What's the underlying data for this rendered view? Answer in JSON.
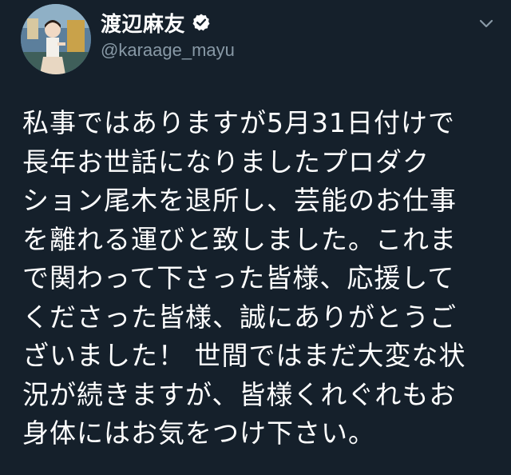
{
  "tweet": {
    "display_name": "渡辺麻友",
    "handle": "@karaage_mayu",
    "verified_icon": "verified-badge-icon",
    "menu_icon": "chevron-down-icon",
    "avatar_icon": "profile-photo",
    "text": "私事ではありますが5月31日付けで\n長年お世話になりましたプロダク\nション尾木を退所し、芸能のお仕事\nを離れる運びと致しました。これま\nで関わって下さった皆様、応援して\nくださった皆様、誠にありがとうご\nざいました！ 世間ではまだ大変な状\n況が続きますが、皆様くれぐれもお\n身体にはお気をつけ下さい。"
  },
  "colors": {
    "background": "#15202b",
    "text": "#ffffff",
    "handle": "#8899a6",
    "verified": "#ffffff"
  }
}
